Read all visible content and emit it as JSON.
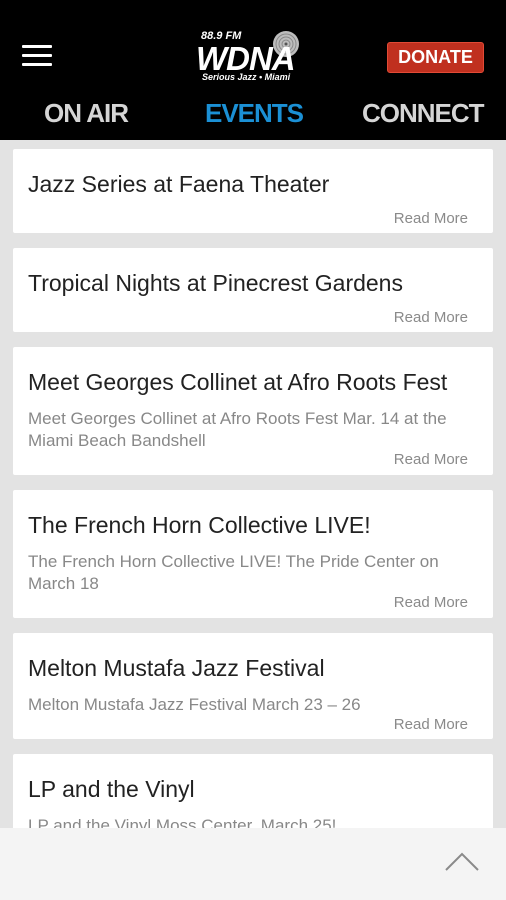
{
  "header": {
    "logo": {
      "frequency": "88.9 FM",
      "name": "WDNA",
      "tagline": "Serious Jazz • Miami"
    },
    "donate_label": "DONATE",
    "tabs": [
      {
        "label": "ON AIR",
        "active": false
      },
      {
        "label": "EVENTS",
        "active": true
      },
      {
        "label": "CONNECT",
        "active": false
      }
    ],
    "accent_color": "#1b90d5",
    "donate_color": "#c0301f"
  },
  "events": [
    {
      "title": "Jazz Series at Faena Theater",
      "description": "",
      "read_more": "Read More"
    },
    {
      "title": "Tropical Nights at Pinecrest Gardens",
      "description": "",
      "read_more": "Read More"
    },
    {
      "title": "Meet Georges Collinet at Afro Roots Fest",
      "description": "Meet Georges Collinet at Afro Roots Fest Mar. 14 at the Miami Beach Bandshell",
      "read_more": "Read More"
    },
    {
      "title": "The French Horn Collective LIVE!",
      "description": "The French Horn Collective LIVE! The Pride Center on March 18",
      "read_more": "Read More"
    },
    {
      "title": "Melton Mustafa Jazz Festival",
      "description": "Melton Mustafa Jazz Festival March 23 – 26",
      "read_more": "Read More"
    },
    {
      "title": "LP and the Vinyl",
      "description": "LP and the Vinyl Moss Center, March 25!",
      "read_more": ""
    }
  ],
  "footer": {
    "scroll_top_icon": "chevron-up-icon"
  }
}
